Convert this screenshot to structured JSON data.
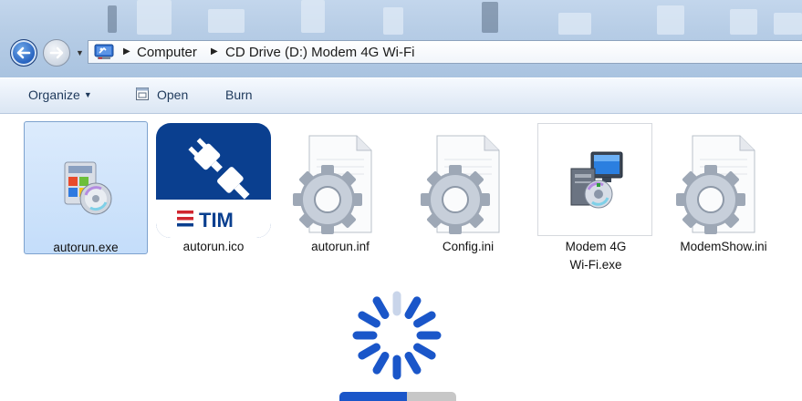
{
  "address_bar": {
    "breadcrumbs": [
      "Computer",
      "CD Drive (D:) Modem 4G Wi-Fi"
    ]
  },
  "toolbar": {
    "organize_label": "Organize",
    "open_label": "Open",
    "burn_label": "Burn"
  },
  "files": [
    {
      "label": "autorun.exe",
      "icon": "installer-icon",
      "selected": true
    },
    {
      "label": "autorun.ico",
      "icon": "tim-plug-icon",
      "selected": false
    },
    {
      "label": "autorun.inf",
      "icon": "settings-file-icon",
      "selected": false
    },
    {
      "label": "Config.ini",
      "icon": "settings-file-icon",
      "selected": false
    },
    {
      "label": "Modem 4G Wi-Fi.exe",
      "icon": "setup-icon",
      "selected": false
    },
    {
      "label": "ModemShow.ini",
      "icon": "settings-file-icon",
      "selected": false
    }
  ],
  "tim_logo_text": "TIM",
  "loading": {
    "progress": 0.58
  },
  "colors": {
    "accent_blue": "#1a56c9",
    "tim_blue": "#0a3f8f",
    "tim_red": "#d0262f",
    "selection_bg": "#cde2fb"
  }
}
